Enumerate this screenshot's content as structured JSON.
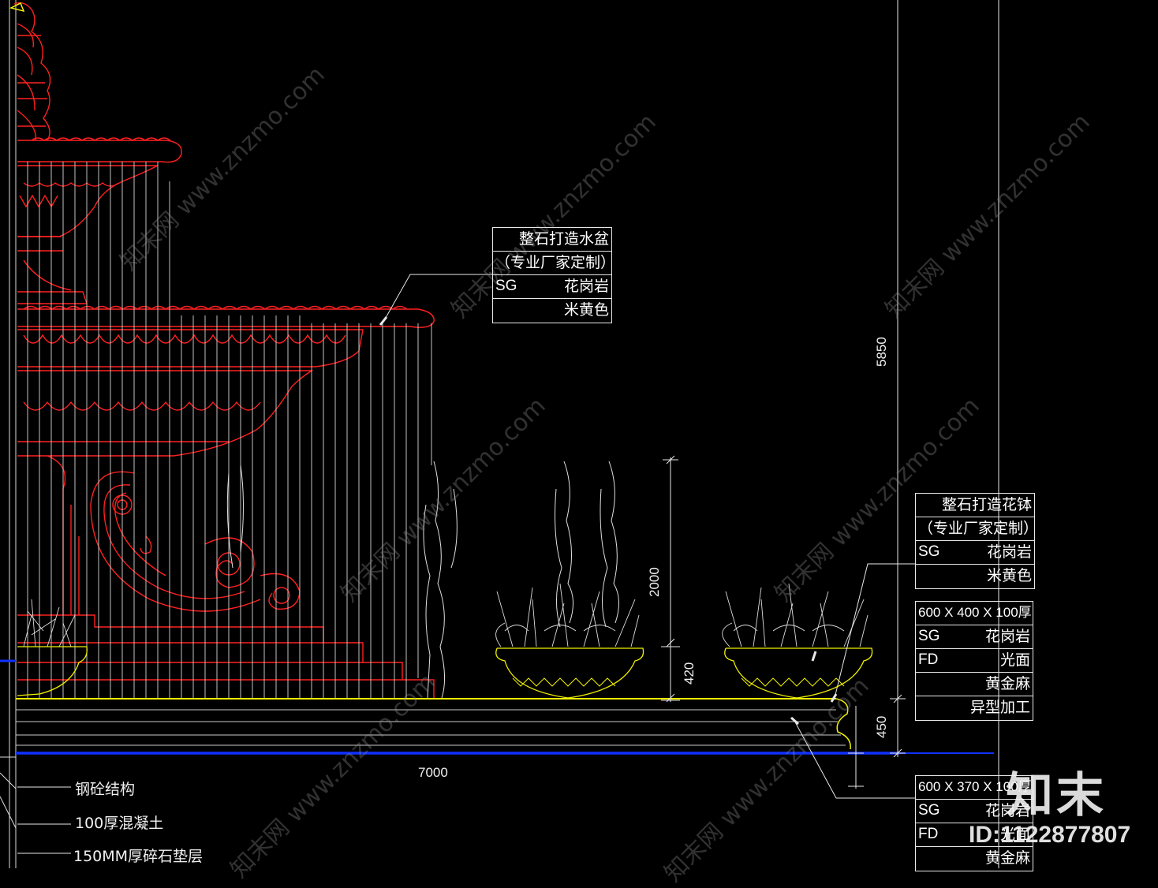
{
  "labels": {
    "basin": {
      "title": "整石打造水盆",
      "custom": "（专业厂家定制）",
      "code": "SG",
      "material": "花岗岩",
      "color": "米黄色"
    },
    "planter": {
      "title": "整石打造花钵",
      "custom": "（专业厂家定制）",
      "code": "SG",
      "material": "花岗岩",
      "color": "米黄色"
    },
    "coping": {
      "size": "600 X 400 X 100厚",
      "code1": "SG",
      "material": "花岗岩",
      "code2": "FD",
      "finish": "光面",
      "stone": "黄金麻",
      "process": "异型加工"
    },
    "step": {
      "size": "600 X 370 X 100厚",
      "code1": "SG",
      "material": "花岗岩",
      "code2": "FD",
      "finish": "光面",
      "stone": "黄金麻"
    },
    "layers": [
      "钢砼结构",
      "100厚混凝土",
      "150MM厚碎石垫层"
    ]
  },
  "dimensions": {
    "width": "7000",
    "total_height": "5850",
    "plant_height": "2000",
    "pot_height": "420",
    "base_height": "450"
  },
  "watermark": {
    "site": "www.znzmo.com",
    "brand": "知末网",
    "logo": "知末",
    "id": "ID:1122877807"
  },
  "colors": {
    "background": "#000000",
    "fountain": "#ff2020",
    "water": "#d8d8d8",
    "ground": "#f0f000",
    "base_line": "#1030ff",
    "text": "#ffffff"
  }
}
